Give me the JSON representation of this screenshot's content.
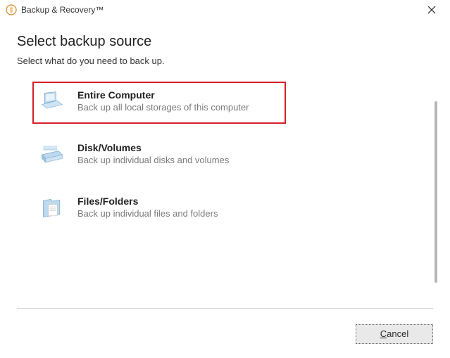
{
  "titlebar": {
    "app_title": "Backup & Recovery™"
  },
  "heading": "Select backup source",
  "subheading": "Select what do you need to back up.",
  "options": [
    {
      "title": "Entire Computer",
      "desc": "Back up all local storages of this computer"
    },
    {
      "title": "Disk/Volumes",
      "desc": "Back up individual disks and volumes"
    },
    {
      "title": "Files/Folders",
      "desc": "Back up individual files and folders"
    }
  ],
  "footer": {
    "cancel_prefix": "C",
    "cancel_rest": "ancel"
  }
}
